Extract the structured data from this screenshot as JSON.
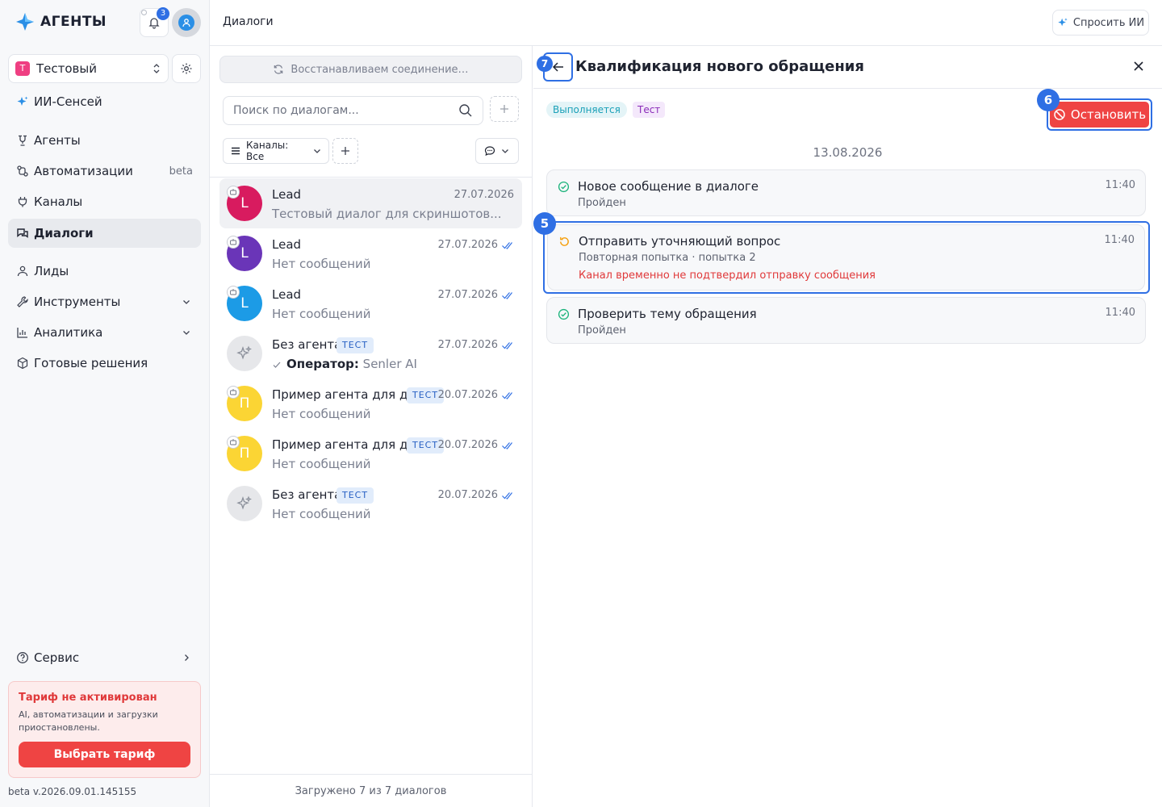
{
  "brand": {
    "name": "АГЕНТЫ"
  },
  "notifications": {
    "count": "3"
  },
  "workspace": {
    "initial": "Т",
    "name": "Тестовый"
  },
  "nav": {
    "ai_sensei": "ИИ-Сенсей",
    "agents": "Агенты",
    "automations": "Автоматизации",
    "automations_badge": "beta",
    "channels": "Каналы",
    "dialogs": "Диалоги",
    "leads": "Лиды",
    "tools": "Инструменты",
    "analytics": "Аналитика",
    "solutions": "Готовые решения",
    "service": "Сервис"
  },
  "tariff": {
    "title": "Тариф не активирован",
    "description": "AI, автоматизации и загрузки приостановлены.",
    "button": "Выбрать тариф"
  },
  "version": "beta v.2026.09.01.145155",
  "topbar": {
    "title": "Диалоги",
    "ask_ai": "Спросить ИИ"
  },
  "list": {
    "reconnecting": "Восстанавливаем соединение…",
    "search_placeholder": "Поиск по диалогам...",
    "channels_filter": "Каналы: Все",
    "footer": "Загружено 7 из 7 диалогов",
    "dialogs": [
      {
        "initial": "L",
        "color": "#d81b5f",
        "name": "Lead",
        "tag": "",
        "date": "27.07.2026",
        "preview": "Тестовый диалог для скриншотов...",
        "preview_prefix": "",
        "checked": false
      },
      {
        "initial": "L",
        "color": "#6a35b8",
        "name": "Lead",
        "tag": "",
        "date": "27.07.2026",
        "preview": "Нет сообщений",
        "preview_prefix": "",
        "checked": true
      },
      {
        "initial": "L",
        "color": "#1c9be6",
        "name": "Lead",
        "tag": "",
        "date": "27.07.2026",
        "preview": "Нет сообщений",
        "preview_prefix": "",
        "checked": true
      },
      {
        "initial": "",
        "color": "#e6e7ea",
        "name": "Без агента",
        "tag": "ТЕСТ",
        "date": "27.07.2026",
        "preview": "Senler AI",
        "preview_prefix": "Оператор:",
        "checked": true
      },
      {
        "initial": "П",
        "color": "#fbd534",
        "name": "Пример агента для д...",
        "tag": "ТЕСТ",
        "date": "20.07.2026",
        "preview": "Нет сообщений",
        "preview_prefix": "",
        "checked": true
      },
      {
        "initial": "П",
        "color": "#fbd534",
        "name": "Пример агента для д...",
        "tag": "ТЕСТ",
        "date": "20.07.2026",
        "preview": "Нет сообщений",
        "preview_prefix": "",
        "checked": true
      },
      {
        "initial": "",
        "color": "#e6e7ea",
        "name": "Без агента",
        "tag": "ТЕСТ",
        "date": "20.07.2026",
        "preview": "Нет сообщений",
        "preview_prefix": "",
        "checked": true
      }
    ]
  },
  "detail": {
    "title": "Квалификация нового обращения",
    "status": "Выполняется",
    "tag": "Тест",
    "stop_button": "Остановить",
    "date": "13.08.2026",
    "markers": {
      "back": "7",
      "stop": "6",
      "step": "5"
    },
    "steps": [
      {
        "title": "Новое сообщение в диалоге",
        "subtitle": "Пройден",
        "error": "",
        "time": "11:40",
        "state": "done"
      },
      {
        "title": "Отправить уточняющий вопрос",
        "subtitle": "Повторная попытка · попытка 2",
        "error": "Канал временно не подтвердил отправку сообщения",
        "time": "11:40",
        "state": "retry"
      },
      {
        "title": "Проверить тему обращения",
        "subtitle": "Пройден",
        "error": "",
        "time": "11:40",
        "state": "done"
      }
    ]
  },
  "colors": {
    "accent": "#2f6fe4",
    "danger": "#ef4443",
    "success": "#1bb37b",
    "warning": "#f59e0b"
  }
}
